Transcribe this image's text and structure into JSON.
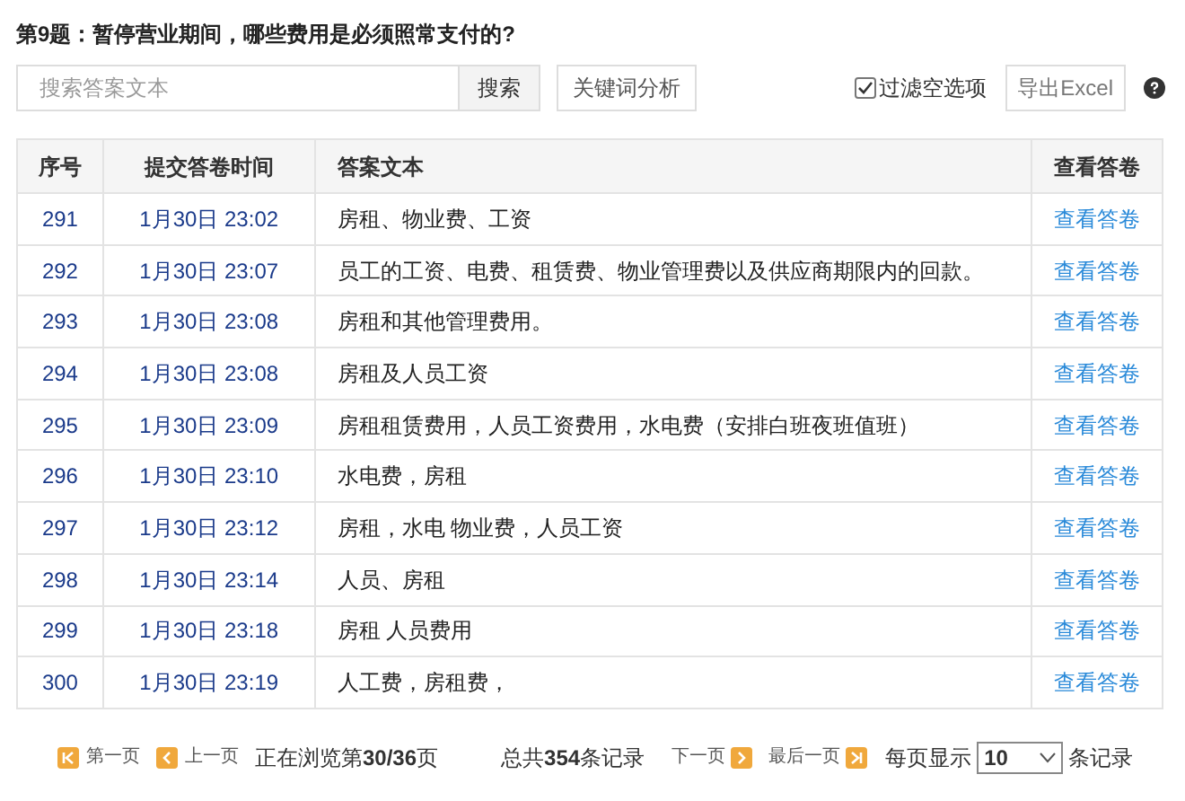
{
  "question": "第9题：暂停营业期间，哪些费用是必须照常支付的?",
  "search": {
    "placeholder": "搜索答案文本",
    "button": "搜索"
  },
  "keyword_button": "关键词分析",
  "filter": {
    "label": "过滤空选项",
    "checked": true
  },
  "export_button": "导出Excel",
  "table": {
    "columns": [
      "序号",
      "提交答卷时间",
      "答案文本",
      "查看答卷"
    ],
    "rows": [
      {
        "no": "291",
        "time": "1月30日 23:02",
        "answer": "房租、物业费、工资",
        "link": "查看答卷"
      },
      {
        "no": "292",
        "time": "1月30日 23:07",
        "answer": "员工的工资、电费、租赁费、物业管理费以及供应商期限内的回款。",
        "link": "查看答卷"
      },
      {
        "no": "293",
        "time": "1月30日 23:08",
        "answer": "房租和其他管理费用。",
        "link": "查看答卷"
      },
      {
        "no": "294",
        "time": "1月30日 23:08",
        "answer": "房租及人员工资",
        "link": "查看答卷"
      },
      {
        "no": "295",
        "time": "1月30日 23:09",
        "answer": "房租租赁费用，人员工资费用，水电费（安排白班夜班值班）",
        "link": "查看答卷"
      },
      {
        "no": "296",
        "time": "1月30日 23:10",
        "answer": "水电费，房租",
        "link": "查看答卷"
      },
      {
        "no": "297",
        "time": "1月30日 23:12",
        "answer": "房租，水电 物业费，人员工资",
        "link": "查看答卷"
      },
      {
        "no": "298",
        "time": "1月30日 23:14",
        "answer": "人员、房租",
        "link": "查看答卷"
      },
      {
        "no": "299",
        "time": "1月30日 23:18",
        "answer": "房租 人员费用",
        "link": "查看答卷"
      },
      {
        "no": "300",
        "time": "1月30日 23:19",
        "answer": "人工费，房租费，",
        "link": "查看答卷"
      }
    ]
  },
  "pager": {
    "first": "第一页",
    "prev": "上一页",
    "status": "正在浏览第**30/36**页",
    "total": "总共**354**条记录",
    "next": "下一页",
    "last": "最后一页",
    "per_page_label": "每页显示",
    "per_page": "10",
    "per_page_suffix": "条记录"
  }
}
